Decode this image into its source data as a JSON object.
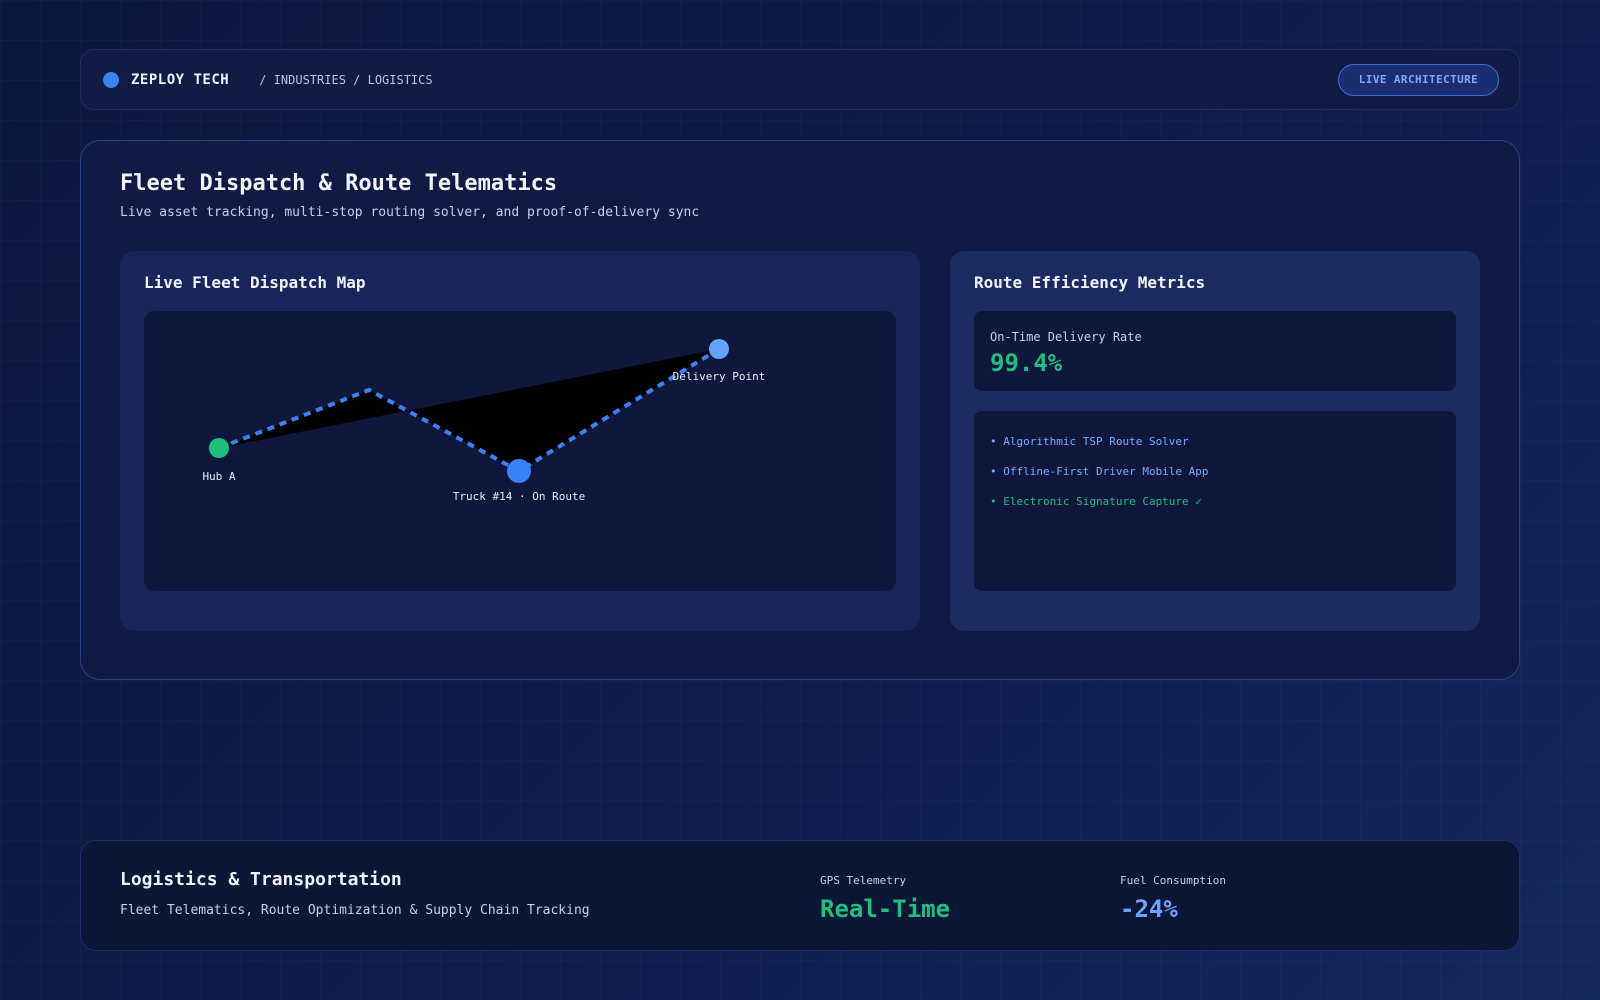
{
  "header": {
    "brand": "ZEPLOY TECH",
    "breadcrumb": "/ INDUSTRIES / LOGISTICS",
    "live_button": "LIVE ARCHITECTURE"
  },
  "hero": {
    "title": "Fleet Dispatch & Route Telematics",
    "subtitle": "Live asset tracking, multi-stop routing solver, and proof-of-delivery sync"
  },
  "map_panel": {
    "title": "Live Fleet Dispatch Map",
    "markers": {
      "hub": "Hub A",
      "truck": "Truck #14 · On Route",
      "delivery": "Delivery Point"
    }
  },
  "metrics_panel": {
    "title": "Route Efficiency Metrics",
    "kpi_label": "On-Time Delivery Rate",
    "kpi_value": "99.4%",
    "features": [
      "• Algorithmic TSP Route Solver",
      "• Offline-First Driver Mobile App",
      "• Electronic Signature Capture ✓"
    ]
  },
  "footer": {
    "title": "Logistics & Transportation",
    "subtitle": "Fleet Telematics, Route Optimization & Supply Chain Tracking",
    "stats": [
      {
        "label": "GPS Telemetry",
        "value": "Real-Time"
      },
      {
        "label": "Fuel Consumption",
        "value": "-24%"
      }
    ]
  },
  "colors": {
    "accent_blue": "#3b82f6",
    "success_green": "#1fbf80",
    "delivery_blue": "#60a5fa"
  }
}
